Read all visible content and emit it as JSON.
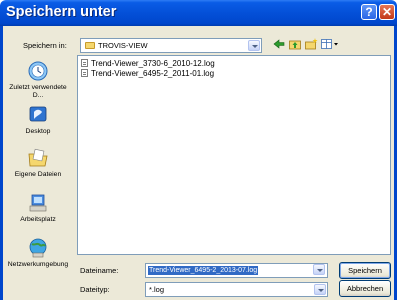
{
  "window": {
    "title": "Speichern unter"
  },
  "titlebar": {
    "help_glyph": "?",
    "close_glyph": "✕"
  },
  "toolbar": {
    "save_in_label": "Speichern in:",
    "current_folder": "TROVIS-VIEW",
    "icons": [
      "back-icon",
      "up-folder-icon",
      "new-folder-icon",
      "views-menu-icon"
    ]
  },
  "places": [
    {
      "label": "Zuletzt verwendete D...",
      "icon": "recent-documents-icon"
    },
    {
      "label": "Desktop",
      "icon": "desktop-icon"
    },
    {
      "label": "Eigene Dateien",
      "icon": "my-documents-icon"
    },
    {
      "label": "Arbeitsplatz",
      "icon": "my-computer-icon"
    },
    {
      "label": "Netzwerkumgebung",
      "icon": "network-icon"
    }
  ],
  "files": [
    {
      "name": "Trend-Viewer_3730-6_2010-12.log"
    },
    {
      "name": "Trend-Viewer_6495-2_2011-01.log"
    }
  ],
  "filename": {
    "label": "Dateiname:",
    "value": "Trend-Viewer_6495-2_2013-07.log"
  },
  "filetype": {
    "label": "Dateityp:",
    "value": "*.log"
  },
  "buttons": {
    "save": "Speichern",
    "cancel": "Abbrechen"
  },
  "colors": {
    "titlebar": "#0450d8",
    "dialog_bg": "#ece9d8",
    "selection": "#316ac5"
  }
}
